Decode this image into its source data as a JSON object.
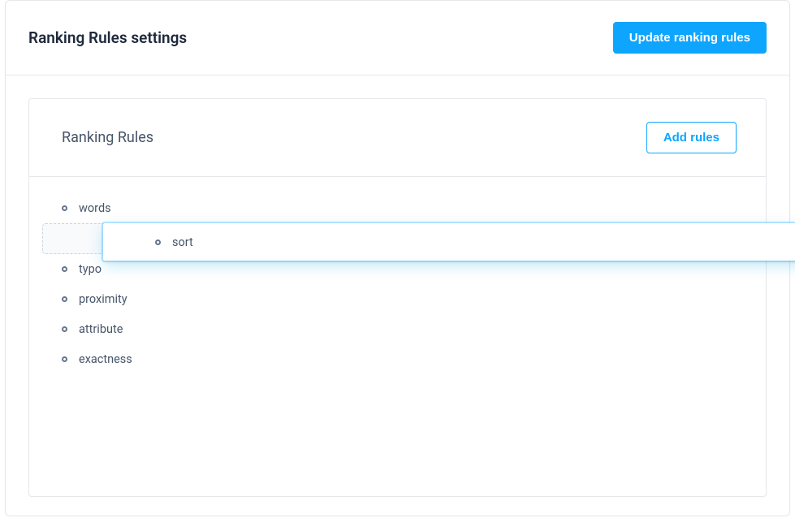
{
  "header": {
    "title": "Ranking Rules settings",
    "update_button_label": "Update ranking rules"
  },
  "panel": {
    "title": "Ranking Rules",
    "add_button_label": "Add rules"
  },
  "rules": {
    "items": [
      {
        "label": "words"
      },
      {
        "label": "sort"
      },
      {
        "label": "typo"
      },
      {
        "label": "proximity"
      },
      {
        "label": "attribute"
      },
      {
        "label": "exactness"
      }
    ],
    "dragging_index": 1,
    "placeholder_index": 1
  },
  "colors": {
    "accent": "#0ea5ff",
    "text": "#475569",
    "border": "#e5e7eb"
  }
}
